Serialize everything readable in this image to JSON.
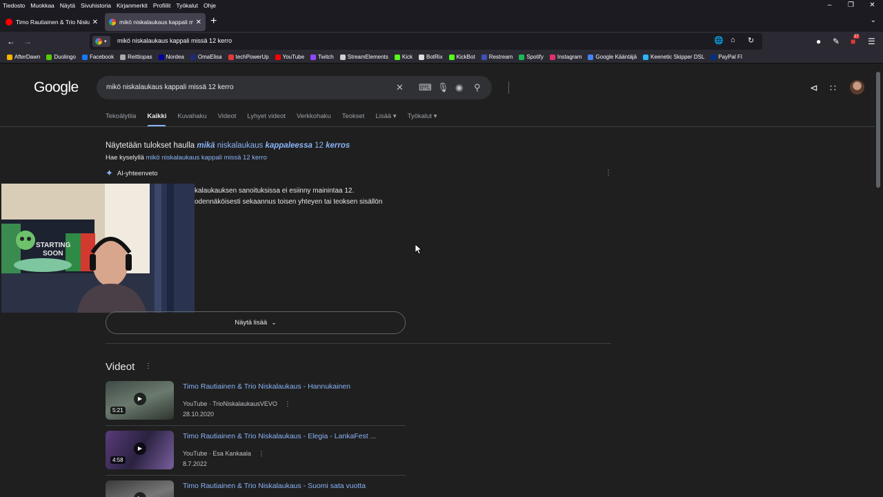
{
  "menubar": [
    "Tiedosto",
    "Muokkaa",
    "Näytä",
    "Sivuhistoria",
    "Kirjanmerkit",
    "Profiilit",
    "Työkalut",
    "Ohje"
  ],
  "tabs": [
    {
      "title": "Timo Rautiainen & Trio Niskalau",
      "favicon_color": "#ff0000",
      "active": false
    },
    {
      "title": "mikö niskalaukaus kappali missä",
      "favicon_color": "#4285f4",
      "active": true
    }
  ],
  "nav": {
    "url": "mikö niskalaukaus kappali missä 12 kerro",
    "notification_count": "27"
  },
  "bookmarks": [
    {
      "label": "AfterDawn",
      "color": "#f4b400"
    },
    {
      "label": "Duolingo",
      "color": "#58cc02"
    },
    {
      "label": "Facebook",
      "color": "#1877f2"
    },
    {
      "label": "Reittiopas",
      "color": "#aaaaaa"
    },
    {
      "label": "Nordea",
      "color": "#0000a0"
    },
    {
      "label": "OmaElisa",
      "color": "#1e2a78"
    },
    {
      "label": "techPowerUp",
      "color": "#e53935"
    },
    {
      "label": "YouTube",
      "color": "#ff0000"
    },
    {
      "label": "Twitch",
      "color": "#9146ff"
    },
    {
      "label": "StreamElements",
      "color": "#cfcfcf"
    },
    {
      "label": "Kick",
      "color": "#53fc18"
    },
    {
      "label": "BotRix",
      "color": "#dddddd"
    },
    {
      "label": "KickBot",
      "color": "#53fc18"
    },
    {
      "label": "Restream",
      "color": "#3f51b5"
    },
    {
      "label": "Spotify",
      "color": "#1db954"
    },
    {
      "label": "Instagram",
      "color": "#e1306c"
    },
    {
      "label": "Google Kääntäjä",
      "color": "#4285f4"
    },
    {
      "label": "Keenetic Skipper DSL",
      "color": "#29b6f6"
    },
    {
      "label": "PayPal FI",
      "color": "#003087"
    }
  ],
  "google": {
    "logo": "Google",
    "query": "mikö niskalaukaus kappali missä 12 kerro",
    "tabs": [
      "Tekoälytila",
      "Kaikki",
      "Kuvahaku",
      "Videot",
      "Lyhyet videot",
      "Verkkohaku",
      "Teokset",
      "Lisää",
      "Työkalut"
    ],
    "active_tab": "Kaikki"
  },
  "spelling": {
    "prefix": "Näytetään tulokset haulla",
    "w1": "mikä",
    "w2": "niskalaukaus",
    "w3": "kappaleessa",
    "w4": "12",
    "w5": "kerros",
    "search_instead_prefix": "Hae kyselyllä",
    "search_instead_link": "mikö niskalaukaus kappali missä 12 kerro"
  },
  "ai_overview": {
    "label": "AI-yhteenveto",
    "line1": "kalaukauksen sanoituksissa ei esiinny mainintaa 12.",
    "line2": "odennäköisesti sekaannus toisen yhteyen tai teoksen sisällön",
    "show_more": "Näytä lisää"
  },
  "videos": {
    "heading": "Videot",
    "items": [
      {
        "title": "Timo Rautiainen & Trio Niskalaukaus - Hannukainen",
        "source": "YouTube · TrioNiskalaukausVEVO",
        "date": "28.10.2020",
        "duration": "5:21"
      },
      {
        "title": "Timo Rautiainen & Trio Niskalaukaus - Elegia - LankaFest ...",
        "source": "YouTube · Esa Kankaala",
        "date": "8.7.2022",
        "duration": "4:58"
      },
      {
        "title": "Timo Rautiainen & Trio Niskalaukaus - Suomi sata vuotta",
        "source": "",
        "date": "",
        "duration": ""
      }
    ]
  },
  "webcam_text": "STARTING SOON"
}
